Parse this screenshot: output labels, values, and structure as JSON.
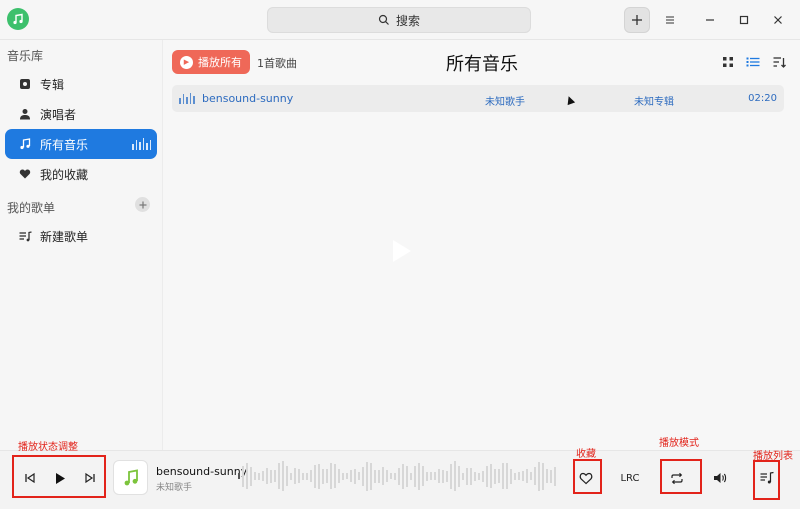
{
  "titlebar": {
    "search_label": "搜索"
  },
  "sidebar": {
    "library_title": "音乐库",
    "items": [
      {
        "label": "专辑",
        "icon": "album-icon"
      },
      {
        "label": "演唱者",
        "icon": "person-icon"
      },
      {
        "label": "所有音乐",
        "icon": "music-note-icon",
        "active": true
      },
      {
        "label": "我的收藏",
        "icon": "heart-icon"
      }
    ],
    "playlists_title": "我的歌单",
    "new_playlist_label": "新建歌单"
  },
  "main": {
    "play_all_label": "播放所有",
    "count_label": "1首歌曲",
    "title": "所有音乐",
    "songs": [
      {
        "title": "bensound-sunny",
        "artist": "未知歌手",
        "album": "未知专辑",
        "duration": "02:20"
      }
    ]
  },
  "player": {
    "title": "bensound-sunny",
    "artist": "未知歌手",
    "lrc_label": "LRC",
    "progress": 0.0
  },
  "annotations": {
    "state_label": "播放状态调整",
    "favorite_label": "收藏",
    "mode_label": "播放模式",
    "playlist_label": "播放列表"
  },
  "colors": {
    "accent_blue": "#1f7ae0",
    "play_all_red": "#ef6858",
    "annotation_red": "#e2231a",
    "logo_green": "#3dc06c"
  }
}
